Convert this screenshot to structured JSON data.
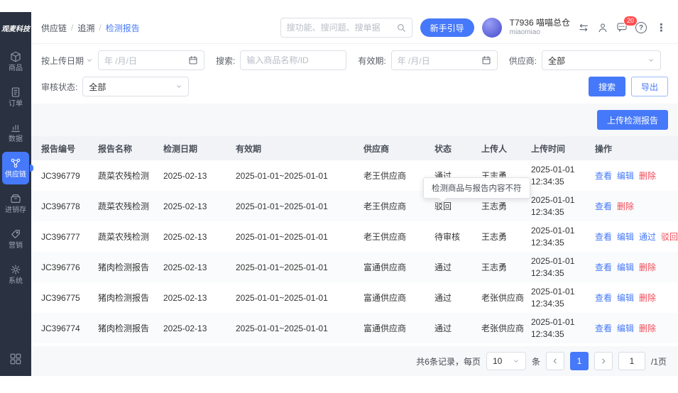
{
  "colors": {
    "accent": "#4679f9",
    "danger": "#f24957",
    "badge": "#ff4d4f",
    "sidebar_bg": "#2a3140"
  },
  "sidebar": {
    "logo": "观麦科技",
    "items": [
      {
        "key": "goods",
        "label": "商品",
        "icon": "box-icon",
        "active": false
      },
      {
        "key": "orders",
        "label": "订单",
        "icon": "document-icon",
        "active": false
      },
      {
        "key": "data",
        "label": "数据",
        "icon": "chart-icon",
        "active": false
      },
      {
        "key": "supply-chain",
        "label": "供应链",
        "icon": "link-icon",
        "active": true
      },
      {
        "key": "inventory",
        "label": "进销存",
        "icon": "archive-icon",
        "active": false
      },
      {
        "key": "marketing",
        "label": "营销",
        "icon": "tag-icon",
        "active": false
      },
      {
        "key": "system",
        "label": "系统",
        "icon": "gear-icon",
        "active": false
      }
    ]
  },
  "header": {
    "breadcrumb": [
      "供应链",
      "追溯",
      "检测报告"
    ],
    "search_placeholder": "搜功能、搜问题、搜单据",
    "guide_button": "新手引导",
    "tenant_name": "T7936 喵喵总仓",
    "tenant_account": "miaomiao",
    "badge_count": "20"
  },
  "filters": {
    "upload_date_label": "按上传日期",
    "date_placeholder": "年 /月/日",
    "search_label": "搜索:",
    "product_placeholder": "输入商品名称/ID",
    "validity_label": "有效期:",
    "supplier_label": "供应商:",
    "supplier_value": "全部",
    "status_label": "审核状态:",
    "status_value": "全部",
    "search_btn": "搜索",
    "export_btn": "导出"
  },
  "toolbar": {
    "upload_button": "上传检测报告"
  },
  "table": {
    "headers": [
      "报告编号",
      "报告名称",
      "检测日期",
      "有效期",
      "供应商",
      "状态",
      "上传人",
      "上传时间",
      "操作"
    ],
    "rows": [
      {
        "id": "JC396779",
        "name": "蔬菜农残检测",
        "date": "2025-02-13",
        "validity": "2025-01-01~2025-01-01",
        "supplier": "老王供应商",
        "status": "通过",
        "uploader": "王志勇",
        "upload_date": "2025-01-01",
        "upload_clock": "12:34:35",
        "actions": [
          {
            "key": "view",
            "label": "查看",
            "color": "blue"
          },
          {
            "key": "edit",
            "label": "编辑",
            "color": "blue"
          },
          {
            "key": "delete",
            "label": "删除",
            "color": "red"
          }
        ]
      },
      {
        "id": "JC396778",
        "name": "蔬菜农残检测",
        "date": "2025-02-13",
        "validity": "2025-01-01~2025-01-01",
        "supplier": "老王供应商",
        "status": "驳回",
        "uploader": "王志勇",
        "upload_date": "2025-01-01",
        "upload_clock": "12:34:35",
        "actions": [
          {
            "key": "view",
            "label": "查看",
            "color": "blue"
          },
          {
            "key": "delete",
            "label": "删除",
            "color": "red"
          }
        ]
      },
      {
        "id": "JC396777",
        "name": "蔬菜农残检测",
        "date": "2025-02-13",
        "validity": "2025-01-01~2025-01-01",
        "supplier": "老王供应商",
        "status": "待审核",
        "uploader": "王志勇",
        "upload_date": "2025-01-01",
        "upload_clock": "12:34:35",
        "actions": [
          {
            "key": "view",
            "label": "查看",
            "color": "blue"
          },
          {
            "key": "edit",
            "label": "编辑",
            "color": "blue"
          },
          {
            "key": "approve",
            "label": "通过",
            "color": "blue"
          },
          {
            "key": "reject",
            "label": "驳回",
            "color": "red"
          }
        ]
      },
      {
        "id": "JC396776",
        "name": "猪肉检测报告",
        "date": "2025-02-13",
        "validity": "2025-01-01~2025-01-01",
        "supplier": "富通供应商",
        "status": "通过",
        "uploader": "王志勇",
        "upload_date": "2025-01-01",
        "upload_clock": "12:34:35",
        "actions": [
          {
            "key": "view",
            "label": "查看",
            "color": "blue"
          },
          {
            "key": "edit",
            "label": "编辑",
            "color": "blue"
          },
          {
            "key": "delete",
            "label": "删除",
            "color": "red"
          }
        ]
      },
      {
        "id": "JC396775",
        "name": "猪肉检测报告",
        "date": "2025-02-13",
        "validity": "2025-01-01~2025-01-01",
        "supplier": "富通供应商",
        "status": "通过",
        "uploader": "老张供应商",
        "upload_date": "2025-01-01",
        "upload_clock": "12:34:35",
        "actions": [
          {
            "key": "view",
            "label": "查看",
            "color": "blue"
          },
          {
            "key": "edit",
            "label": "编辑",
            "color": "blue"
          },
          {
            "key": "delete",
            "label": "删除",
            "color": "red"
          }
        ]
      },
      {
        "id": "JC396774",
        "name": "猪肉检测报告",
        "date": "2025-02-13",
        "validity": "2025-01-01~2025-01-01",
        "supplier": "富通供应商",
        "status": "通过",
        "uploader": "老张供应商",
        "upload_date": "2025-01-01",
        "upload_clock": "12:34:35",
        "actions": [
          {
            "key": "view",
            "label": "查看",
            "color": "blue"
          },
          {
            "key": "edit",
            "label": "编辑",
            "color": "blue"
          },
          {
            "key": "delete",
            "label": "删除",
            "color": "red"
          }
        ]
      }
    ]
  },
  "tooltip": {
    "text": "检测商品与报告内容不符"
  },
  "pagination": {
    "total_text": "共6条记录，每页",
    "page_size": "10",
    "unit": "条",
    "current_page": "1",
    "jump_value": "1",
    "total_pages": "/1页"
  }
}
